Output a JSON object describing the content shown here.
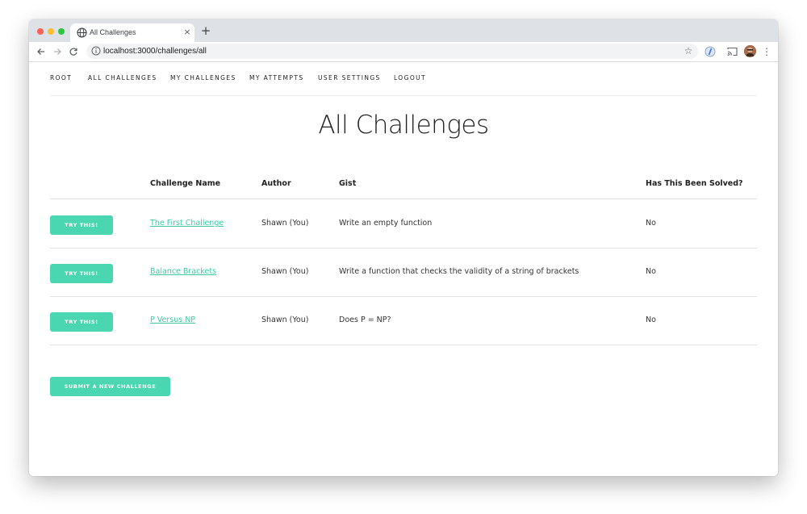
{
  "browser": {
    "tab_title": "All Challenges",
    "tab_close": "×",
    "new_tab": "+",
    "url": "localhost:3000/challenges/all"
  },
  "nav": {
    "items": [
      "ROOT",
      "ALL CHALLENGES",
      "MY CHALLENGES",
      "MY ATTEMPTS",
      "USER SETTINGS",
      "LOGOUT"
    ]
  },
  "page": {
    "title": "All Challenges"
  },
  "table": {
    "headers": [
      "Challenge Name",
      "Author",
      "Gist",
      "Has This Been Solved?"
    ],
    "rows": [
      {
        "action": "TRY THIS!",
        "name": "The First Challenge",
        "author": "Shawn (You)",
        "gist": "Write an empty function",
        "solved": "No"
      },
      {
        "action": "TRY THIS!",
        "name": "Balance Brackets",
        "author": "Shawn (You)",
        "gist": "Write a function that checks the validity of a string of brackets",
        "solved": "No"
      },
      {
        "action": "TRY THIS!",
        "name": "P Versus NP",
        "author": "Shawn (You)",
        "gist": "Does P = NP?",
        "solved": "No"
      }
    ]
  },
  "submit_label": "SUBMIT A NEW CHALLENGE",
  "colors": {
    "accent": "#4ad6b0",
    "link": "#3fc9a4"
  },
  "icons": [
    "globe-icon",
    "close-icon",
    "back-icon",
    "forward-icon",
    "reload-icon",
    "info-icon",
    "star-icon",
    "extension-icon",
    "cast-icon",
    "menu-icon"
  ]
}
